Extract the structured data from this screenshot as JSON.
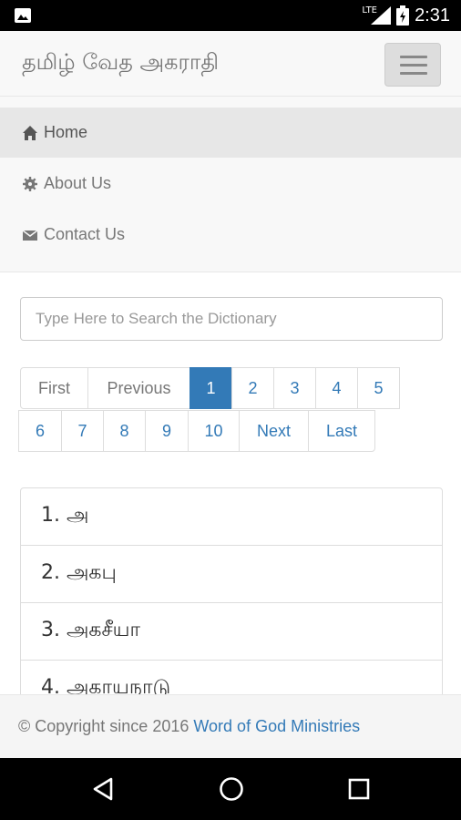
{
  "status_bar": {
    "network": "LTE",
    "time": "2:31"
  },
  "header": {
    "title": "தமிழ் வேத அகராதி"
  },
  "menu": {
    "items": [
      {
        "label": "Home",
        "icon": "home-icon"
      },
      {
        "label": "About Us",
        "icon": "gear-icon"
      },
      {
        "label": "Contact Us",
        "icon": "envelope-icon"
      }
    ]
  },
  "search": {
    "placeholder": "Type Here to Search the Dictionary"
  },
  "pagination": {
    "first": "First",
    "previous": "Previous",
    "pages": [
      "1",
      "2",
      "3",
      "4",
      "5",
      "6",
      "7",
      "8",
      "9",
      "10"
    ],
    "next": "Next",
    "last": "Last",
    "current": "1"
  },
  "entries": [
    "1. அ",
    "2. அகபு",
    "3. அகசீயா",
    "4. அகாயநாடு"
  ],
  "footer": {
    "copyright": "© Copyright since 2016",
    "link": "Word of God Ministries"
  },
  "colors": {
    "link": "#337ab7",
    "active_page": "#337ab7",
    "navbar_bg": "#f8f8f8"
  }
}
